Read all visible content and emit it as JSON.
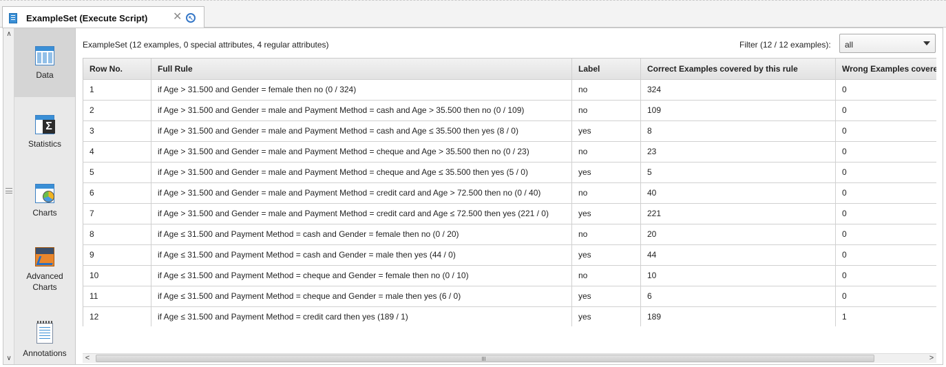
{
  "tab": {
    "title": "ExampleSet (Execute Script)",
    "close_glyph": "✕",
    "restore_glyph": "↖"
  },
  "sidebar": {
    "scroll_up": "∧",
    "scroll_down": "∨",
    "items": [
      {
        "label": "Data",
        "icon": "data-table-icon",
        "active": true
      },
      {
        "label": "Statistics",
        "icon": "statistics-icon",
        "active": false
      },
      {
        "label": "Charts",
        "icon": "charts-icon",
        "active": false
      },
      {
        "label": "Advanced Charts",
        "icon": "advanced-charts-icon",
        "active": false
      },
      {
        "label": "Annotations",
        "icon": "annotations-icon",
        "active": false
      }
    ]
  },
  "main": {
    "summary": "ExampleSet (12 examples, 0 special attributes, 4 regular attributes)",
    "filter_label": "Filter (12 / 12 examples):",
    "filter_value": "all",
    "columns": [
      "Row No.",
      "Full Rule",
      "Label",
      "Correct Examples covered by this rule",
      "Wrong Examples covered by this rule"
    ],
    "rows": [
      [
        "1",
        "if Age > 31.500 and Gender = female then no  (0 / 324)",
        "no",
        "324",
        "0"
      ],
      [
        "2",
        "if Age > 31.500 and Gender = male and Payment Method = cash and Age > 35.500 then no  (0 / 109)",
        "no",
        "109",
        "0"
      ],
      [
        "3",
        "if Age > 31.500 and Gender = male and Payment Method = cash and Age ≤ 35.500 then yes  (8 / 0)",
        "yes",
        "8",
        "0"
      ],
      [
        "4",
        "if Age > 31.500 and Gender = male and Payment Method = cheque and Age > 35.500 then no  (0 / 23)",
        "no",
        "23",
        "0"
      ],
      [
        "5",
        "if Age > 31.500 and Gender = male and Payment Method = cheque and Age ≤ 35.500 then yes  (5 / 0)",
        "yes",
        "5",
        "0"
      ],
      [
        "6",
        "if Age > 31.500 and Gender = male and Payment Method = credit card and Age > 72.500 then no  (0 / 40)",
        "no",
        "40",
        "0"
      ],
      [
        "7",
        "if Age > 31.500 and Gender = male and Payment Method = credit card and Age ≤ 72.500 then yes  (221 / 0)",
        "yes",
        "221",
        "0"
      ],
      [
        "8",
        "if Age ≤ 31.500 and Payment Method = cash and Gender = female then no  (0 / 20)",
        "no",
        "20",
        "0"
      ],
      [
        "9",
        "if Age ≤ 31.500 and Payment Method = cash and Gender = male then yes  (44 / 0)",
        "yes",
        "44",
        "0"
      ],
      [
        "10",
        "if Age ≤ 31.500 and Payment Method = cheque and Gender = female then no  (0 / 10)",
        "no",
        "10",
        "0"
      ],
      [
        "11",
        "if Age ≤ 31.500 and Payment Method = cheque and Gender = male then yes  (6 / 0)",
        "yes",
        "6",
        "0"
      ],
      [
        "12",
        "if Age ≤ 31.500 and Payment Method = credit card then yes  (189 / 1)",
        "yes",
        "189",
        "1"
      ]
    ]
  },
  "hscroll": {
    "left": "<",
    "right": ">"
  }
}
